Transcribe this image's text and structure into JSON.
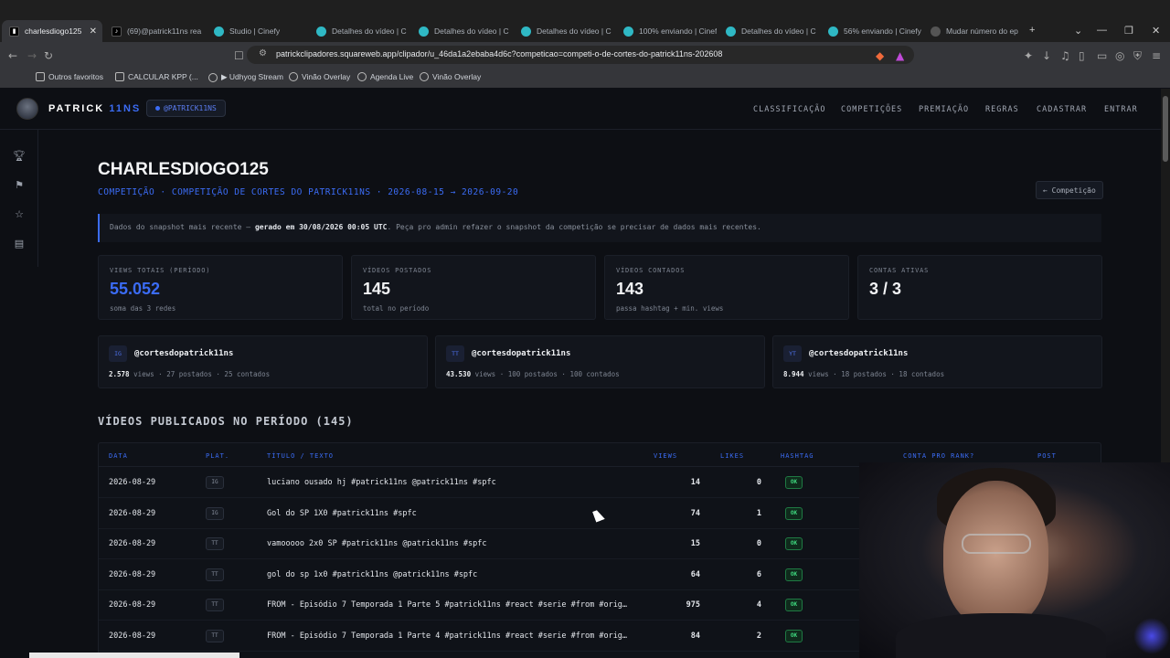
{
  "browser": {
    "tabs": [
      {
        "title": "charlesdiogo125",
        "icon": "page-icon",
        "active": true
      },
      {
        "title": "(69)@patrick11ns rea",
        "icon": "tiktok-icon"
      },
      {
        "title": "Studio | Cinefy",
        "icon": "cinefy-icon"
      },
      {
        "title": "Detalhes do vídeo | C",
        "icon": "cinefy-icon"
      },
      {
        "title": "Detalhes do vídeo | C",
        "icon": "cinefy-icon"
      },
      {
        "title": "Detalhes do vídeo | C",
        "icon": "cinefy-icon"
      },
      {
        "title": "100% enviando | Cinef",
        "icon": "cinefy-icon"
      },
      {
        "title": "Detalhes do vídeo | C",
        "icon": "cinefy-icon"
      },
      {
        "title": "56% enviando | Cinefy",
        "icon": "cinefy-icon"
      },
      {
        "title": "Mudar número do ep",
        "icon": "settings-icon"
      }
    ],
    "url": "patrickclipadores.squareweb.app/clipador/u_46da1a2ebaba4d6c?competicao=competi-o-de-cortes-do-patrick11ns-202608",
    "bookmarks": [
      {
        "label": "Outros favoritos",
        "icon": "folder-icon"
      },
      {
        "label": "CALCULAR KPP (...",
        "icon": "calc-icon"
      },
      {
        "label": "▶ Udhyog Stream",
        "icon": "globe-icon"
      },
      {
        "label": "Vinão Overlay",
        "icon": "globe-icon"
      },
      {
        "label": "Agenda Live",
        "icon": "bolt-icon"
      },
      {
        "label": "Vinão Overlay",
        "icon": "globe-icon"
      }
    ]
  },
  "site": {
    "brand_a": "PATRICK ",
    "brand_b": "11NS",
    "handle": "@PATRICK11NS",
    "nav": [
      "CLASSIFICAÇÃO",
      "COMPETIÇÕES",
      "PREMIAÇÃO",
      "REGRAS",
      "CADASTRAR",
      "ENTRAR"
    ]
  },
  "header": {
    "title": "CHARLESDIOGO125",
    "subtitle": "COMPETIÇÃO · COMPETIÇÃO DE CORTES DO PATRICK11NS · 2026-08-15 → 2026-09-20",
    "back_button": "← Competição"
  },
  "notice": {
    "prefix": "Dados do snapshot mais recente — ",
    "bold": "gerado em 30/08/2026 00:05 UTC",
    "suffix": ". Peça pro admin refazer o snapshot da competição se precisar de dados mais recentes."
  },
  "stats": [
    {
      "label": "VIEWS TOTAIS (PERÍODO)",
      "value": "55.052",
      "sub": "soma das 3 redes",
      "highlight": true
    },
    {
      "label": "VÍDEOS POSTADOS",
      "value": "145",
      "sub": "total no período"
    },
    {
      "label": "VÍDEOS CONTADOS",
      "value": "143",
      "sub": "passa hashtag + min. views"
    },
    {
      "label": "CONTAS ATIVAS",
      "value": "3 / 3",
      "sub": ""
    }
  ],
  "accounts": [
    {
      "platform": "IG",
      "name": "@cortesdopatrick11ns",
      "views": "2.578",
      "rest": " views · 27 postados · 25 contados"
    },
    {
      "platform": "TT",
      "name": "@cortesdopatrick11ns",
      "views": "43.530",
      "rest": " views · 100 postados · 100 contados"
    },
    {
      "platform": "YT",
      "name": "@cortesdopatrick11ns",
      "views": "8.944",
      "rest": " views · 18 postados · 18 contados"
    }
  ],
  "videos": {
    "section_title": "VÍDEOS PUBLICADOS NO PERÍODO (145)",
    "columns": [
      "DATA",
      "PLAT.",
      "TÍTULO / TEXTO",
      "VIEWS",
      "LIKES",
      "HASHTAG",
      "CONTA PRO RANK?",
      "POST"
    ],
    "rows": [
      {
        "date": "2026-08-29",
        "plat": "IG",
        "title": "luciano ousado hj #patrick11ns @patrick11ns #spfc",
        "views": "14",
        "likes": "0",
        "hashtag": "OK"
      },
      {
        "date": "2026-08-29",
        "plat": "IG",
        "title": "Gol do SP 1X0 #patrick11ns #spfc",
        "views": "74",
        "likes": "1",
        "hashtag": "OK"
      },
      {
        "date": "2026-08-29",
        "plat": "TT",
        "title": "vamooooo 2x0 SP #patrick11ns @patrick11ns #spfc",
        "views": "15",
        "likes": "0",
        "hashtag": "OK"
      },
      {
        "date": "2026-08-29",
        "plat": "TT",
        "title": "gol do sp 1x0 #patrick11ns @patrick11ns #spfc",
        "views": "64",
        "likes": "6",
        "hashtag": "OK"
      },
      {
        "date": "2026-08-29",
        "plat": "TT",
        "title": "FROM - Episódio 7 Temporada 1 Parte 5 #patrick11ns #react #serie #from #orig…",
        "views": "975",
        "likes": "4",
        "hashtag": "OK"
      },
      {
        "date": "2026-08-29",
        "plat": "TT",
        "title": "FROM - Episódio 7 Temporada 1 Parte 4 #patrick11ns #react #serie #from #orig…",
        "views": "84",
        "likes": "2",
        "hashtag": "OK"
      }
    ]
  },
  "colors": {
    "accent": "#3b6cf5",
    "ok": "#3fd97f",
    "bg": "#0d0f14"
  }
}
